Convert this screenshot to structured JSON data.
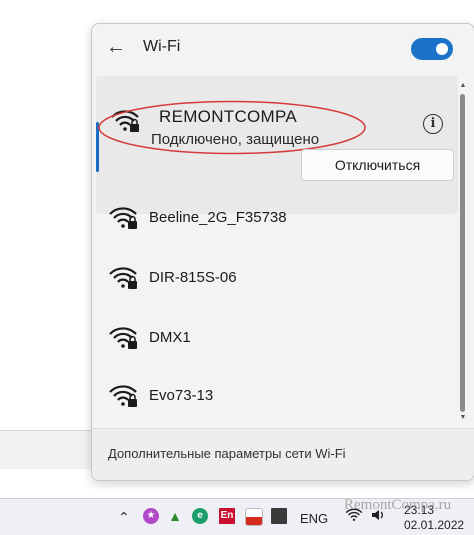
{
  "panel": {
    "title": "Wi-Fi",
    "toggle_on": true,
    "accent_color": "#1a6dc4",
    "highlight_color": "#d63a3a"
  },
  "connected": {
    "ssid": "REMONTCOMPA",
    "status": "Подключено, защищено",
    "disconnect_label": "Отключиться",
    "info_glyph": "i"
  },
  "networks": [
    {
      "ssid": "Beeline_2G_F35738",
      "secured": true
    },
    {
      "ssid": "DIR-815S-06",
      "secured": true
    },
    {
      "ssid": "DMX1",
      "secured": true
    },
    {
      "ssid": "Evo73-13",
      "secured": true
    }
  ],
  "footer": {
    "link": "Дополнительные параметры сети Wi-Fi"
  },
  "taskbar": {
    "language": "ENG",
    "time": "23:13",
    "date": "02.01.2022",
    "tray_icons": [
      "chevron-up-icon",
      "messenger-icon",
      "app-icon",
      "edge-icon",
      "en-icon",
      "flag-icon",
      "display-icon",
      "wifi-icon",
      "volume-icon"
    ]
  },
  "watermark": "RemontCompa.ru"
}
